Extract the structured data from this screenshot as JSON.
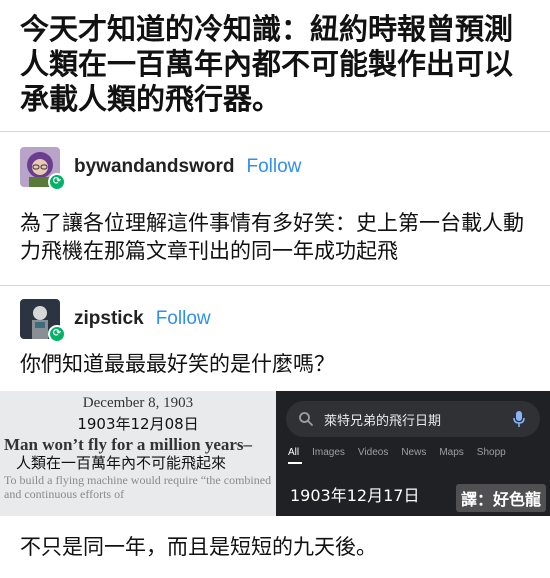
{
  "title": "今天才知道的冷知識：紐約時報曾預測人類在一百萬年內都不可能製作出可以承載人類的飛行器。",
  "posts": [
    {
      "username": "bywandandsword",
      "follow_label": "Follow",
      "avatar_icon": "profile-avatar-icon",
      "text": "為了讓各位理解這件事情有多好笑：史上第一台載人動力飛機在那篇文章刊出的同一年成功起飛"
    },
    {
      "username": "zipstick",
      "follow_label": "Follow",
      "avatar_icon": "profile-avatar-icon",
      "text": "你們知道最最最好笑的是什麼嗎？"
    }
  ],
  "newspaper": {
    "date": "December 8, 1903",
    "date_translation": "1903年12月08日",
    "headline": "Man won’t fly for a million years–",
    "headline_translation": "人類在一百萬年內不可能飛起來",
    "body": "To build a flying machine would require “the combined and continuous efforts of"
  },
  "search": {
    "query": "萊特兄弟的飛行日期",
    "tabs": [
      "All",
      "Images",
      "Videos",
      "News",
      "Maps",
      "Shopp"
    ],
    "active_tab": "All",
    "result": "1903年12月17日",
    "watermark": "譯：好色龍"
  },
  "closing_text": "不只是同一年，而且是短短的九天後。",
  "colors": {
    "follow": "#2f8ff7",
    "reblog_badge": "#00b467",
    "search_bg": "#202124"
  }
}
